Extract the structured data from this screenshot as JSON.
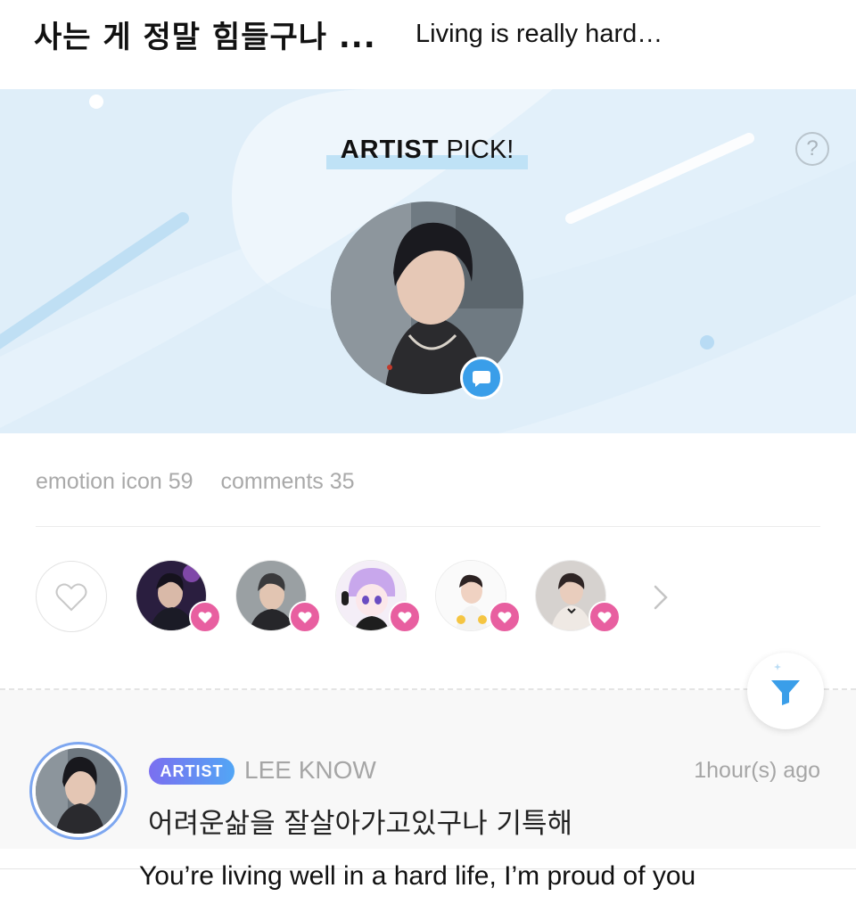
{
  "post": {
    "title": "사는 게 정말 힘들구나 ...",
    "title_translation": "Living is really hard…"
  },
  "hero": {
    "pick_strong": "ARTIST",
    "pick_rest": " PICK!",
    "help_glyph": "?",
    "help_icon": "question-circle",
    "chat_icon": "chat-bubble",
    "colors": {
      "background": "#dfeef9",
      "accent": "#3a9ee9"
    }
  },
  "stats": {
    "emotion": "emotion icon 59",
    "comments": "comments 35"
  },
  "reactions": {
    "like_icon": "heart-outline",
    "reactor_badge_icon": "heart",
    "badge_color": "#e85fa0",
    "more_icon": "chevron-right",
    "reactors": [
      {
        "name": "reactor-1"
      },
      {
        "name": "reactor-2"
      },
      {
        "name": "reactor-3"
      },
      {
        "name": "reactor-4"
      },
      {
        "name": "reactor-5"
      }
    ]
  },
  "filter": {
    "icon": "filter-funnel",
    "color": "#3a9ee9"
  },
  "comment": {
    "badge": "ARTIST",
    "author": "LEE KNOW",
    "time": "1hour(s) ago",
    "text": "어려운삶을 잘살아가고있구나 기특해",
    "translation": "You’re living well in a hard life, I’m proud of you"
  }
}
